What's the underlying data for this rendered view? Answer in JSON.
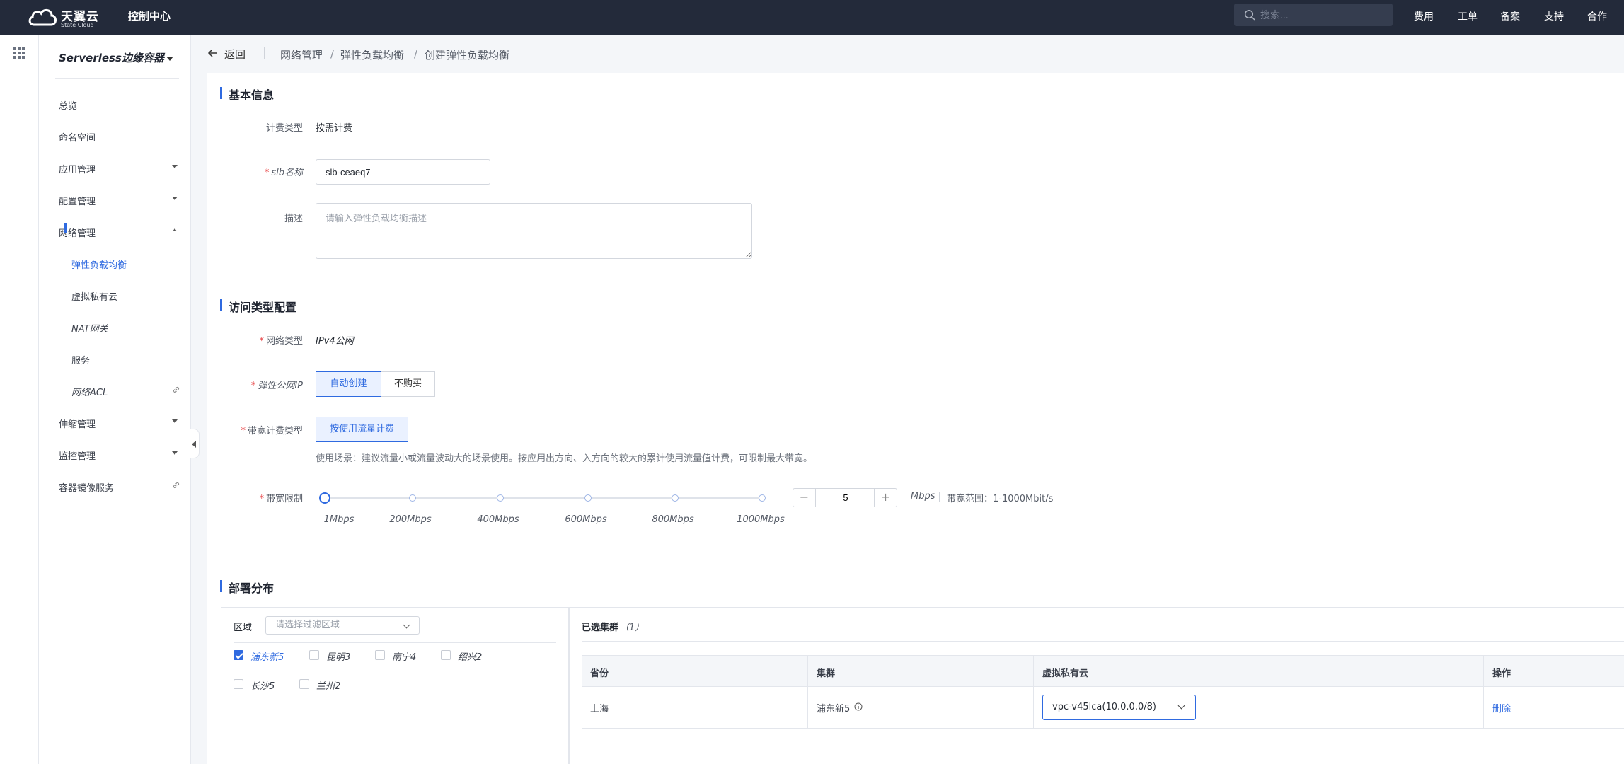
{
  "topbar": {
    "logo_cn": "天翼云",
    "logo_en": "State Cloud",
    "console": "控制中心",
    "search_placeholder": "搜索...",
    "links": [
      "费用",
      "工单",
      "备案",
      "支持",
      "合作"
    ]
  },
  "sidebar": {
    "product": "Serverless边缘容器",
    "items": [
      {
        "label": "总览"
      },
      {
        "label": "命名空间"
      },
      {
        "label": "应用管理"
      },
      {
        "label": "配置管理"
      },
      {
        "label": "网络管理"
      },
      {
        "label": "弹性负载均衡"
      },
      {
        "label": "虚拟私有云"
      },
      {
        "label": "NAT网关"
      },
      {
        "label": "服务"
      },
      {
        "label": "网络ACL"
      },
      {
        "label": "伸缩管理"
      },
      {
        "label": "监控管理"
      },
      {
        "label": "容器镜像服务"
      }
    ]
  },
  "breadcrumb": {
    "back": "返回",
    "items": [
      "网络管理",
      "弹性负载均衡",
      "创建弹性负载均衡"
    ]
  },
  "basic": {
    "title": "基本信息",
    "billing_label": "计费类型",
    "billing_value": "按需计费",
    "name_label": "slb名称",
    "name_value": "slb-ceaeq7",
    "desc_label": "描述",
    "desc_placeholder": "请输入弹性负载均衡描述"
  },
  "access": {
    "title": "访问类型配置",
    "net_type_label": "网络类型",
    "net_type_value": "IPv4公网",
    "eip_label": "弹性公网IP",
    "eip_options": [
      "自动创建",
      "不购买"
    ],
    "eip_selected": "自动创建",
    "bw_billing_label": "带宽计费类型",
    "bw_billing_option": "按使用流量计费",
    "bw_hint": "使用场景：建议流量小或流量波动大的场景使用。按应用出方向、入方向的较大的累计使用流量值计费，可限制最大带宽。",
    "bw_limit_label": "带宽限制",
    "slider_ticks": [
      "1Mbps",
      "200Mbps",
      "400Mbps",
      "600Mbps",
      "800Mbps",
      "1000Mbps"
    ],
    "bw_value": "5",
    "bw_unit": "Mbps",
    "bw_range": "带宽范围：1-1000Mbit/s",
    "minus": "−",
    "plus": "+"
  },
  "deploy": {
    "title": "部署分布",
    "region_label": "区域",
    "region_placeholder": "请选择过滤区域",
    "clusters": [
      {
        "name": "浦东新5",
        "checked": true
      },
      {
        "name": "昆明3",
        "checked": false
      },
      {
        "name": "南宁4",
        "checked": false
      },
      {
        "name": "绍兴2",
        "checked": false
      },
      {
        "name": "长沙5",
        "checked": false
      },
      {
        "name": "兰州2",
        "checked": false
      }
    ],
    "selected_title": "已选集群",
    "selected_count": "（1）",
    "columns": [
      "省份",
      "集群",
      "虚拟私有云",
      "操作"
    ],
    "rows": [
      {
        "province": "上海",
        "cluster": "浦东新5",
        "vpc": "vpc-v45lca(10.0.0.0/8)",
        "action": "删除"
      }
    ]
  }
}
